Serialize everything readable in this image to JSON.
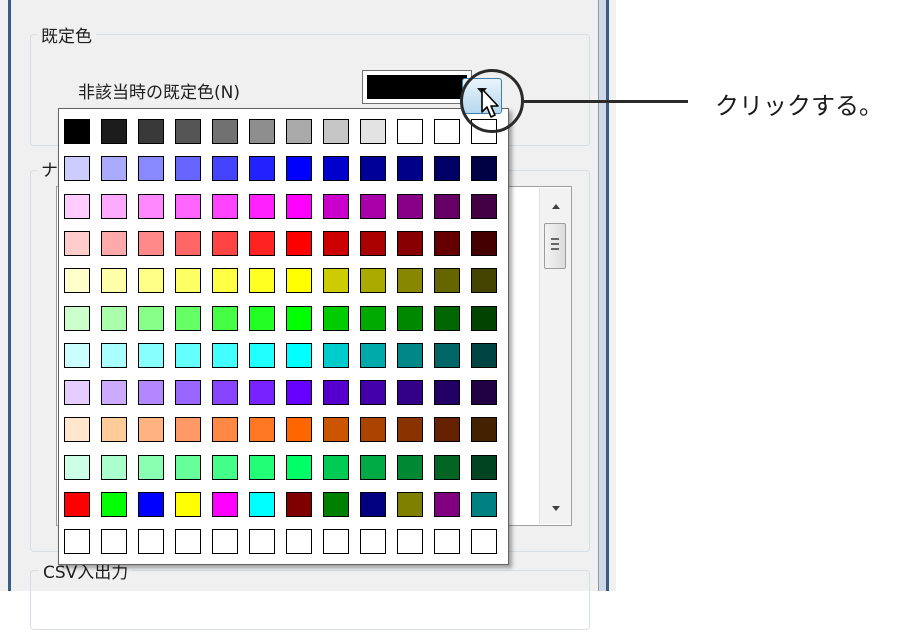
{
  "group_default": {
    "title": "既定色"
  },
  "default_setting": {
    "label": "非該当時の既定色(N)",
    "current_color": "#000000"
  },
  "group_second": {
    "title_fragment": "ナ"
  },
  "group_csv": {
    "title": "CSV入出力"
  },
  "callout": {
    "text": "クリックする。"
  },
  "palette": {
    "rows": [
      [
        "#000000",
        "#1c1c1c",
        "#393939",
        "#555555",
        "#717171",
        "#8e8e8e",
        "#aaaaaa",
        "#c6c6c6",
        "#e3e3e3",
        "#ffffff",
        "#ffffff",
        "#ffffff"
      ],
      [
        "#ccccff",
        "#aaaaff",
        "#8888ff",
        "#6666ff",
        "#4444ff",
        "#2222ff",
        "#0000ff",
        "#0000cc",
        "#000099",
        "#000088",
        "#000066",
        "#000044"
      ],
      [
        "#ffccff",
        "#ffaaff",
        "#ff88ff",
        "#ff66ff",
        "#ff44ff",
        "#ff22ff",
        "#ff00ff",
        "#cc00cc",
        "#aa00aa",
        "#880088",
        "#660066",
        "#440044"
      ],
      [
        "#ffcccc",
        "#ffaaaa",
        "#ff8888",
        "#ff6666",
        "#ff4444",
        "#ff2222",
        "#ff0000",
        "#cc0000",
        "#aa0000",
        "#880000",
        "#660000",
        "#440000"
      ],
      [
        "#ffffcc",
        "#ffffaa",
        "#ffff88",
        "#ffff66",
        "#ffff44",
        "#ffff22",
        "#ffff00",
        "#cccc00",
        "#aaaa00",
        "#888800",
        "#666600",
        "#444400"
      ],
      [
        "#ccffcc",
        "#aaffaa",
        "#88ff88",
        "#66ff66",
        "#44ff44",
        "#22ff22",
        "#00ff00",
        "#00cc00",
        "#00aa00",
        "#008800",
        "#006600",
        "#004400"
      ],
      [
        "#ccffff",
        "#aaffff",
        "#88ffff",
        "#66ffff",
        "#44ffff",
        "#22ffff",
        "#00ffff",
        "#00cccc",
        "#00aaaa",
        "#008888",
        "#006666",
        "#004444"
      ],
      [
        "#e6ccff",
        "#ccaaff",
        "#b388ff",
        "#9966ff",
        "#8844ff",
        "#7722ff",
        "#6600ff",
        "#5500cc",
        "#4400aa",
        "#330088",
        "#220066",
        "#220044"
      ],
      [
        "#ffe6cc",
        "#ffcc99",
        "#ffb380",
        "#ff9966",
        "#ff8844",
        "#ff7722",
        "#ff6600",
        "#cc5500",
        "#aa4400",
        "#883300",
        "#662200",
        "#442200"
      ],
      [
        "#ccffe6",
        "#aaffcc",
        "#88ffb3",
        "#66ff99",
        "#44ff88",
        "#22ff77",
        "#00ff66",
        "#00cc55",
        "#00aa44",
        "#008833",
        "#006622",
        "#004422"
      ],
      [
        "#ff0000",
        "#00ff00",
        "#0000ff",
        "#ffff00",
        "#ff00ff",
        "#00ffff",
        "#800000",
        "#008000",
        "#000080",
        "#808000",
        "#800080",
        "#008080"
      ],
      [
        "#ffffff",
        "#ffffff",
        "#ffffff",
        "#ffffff",
        "#ffffff",
        "#ffffff",
        "#ffffff",
        "#ffffff",
        "#ffffff",
        "#ffffff",
        "#ffffff",
        "#ffffff"
      ]
    ]
  }
}
